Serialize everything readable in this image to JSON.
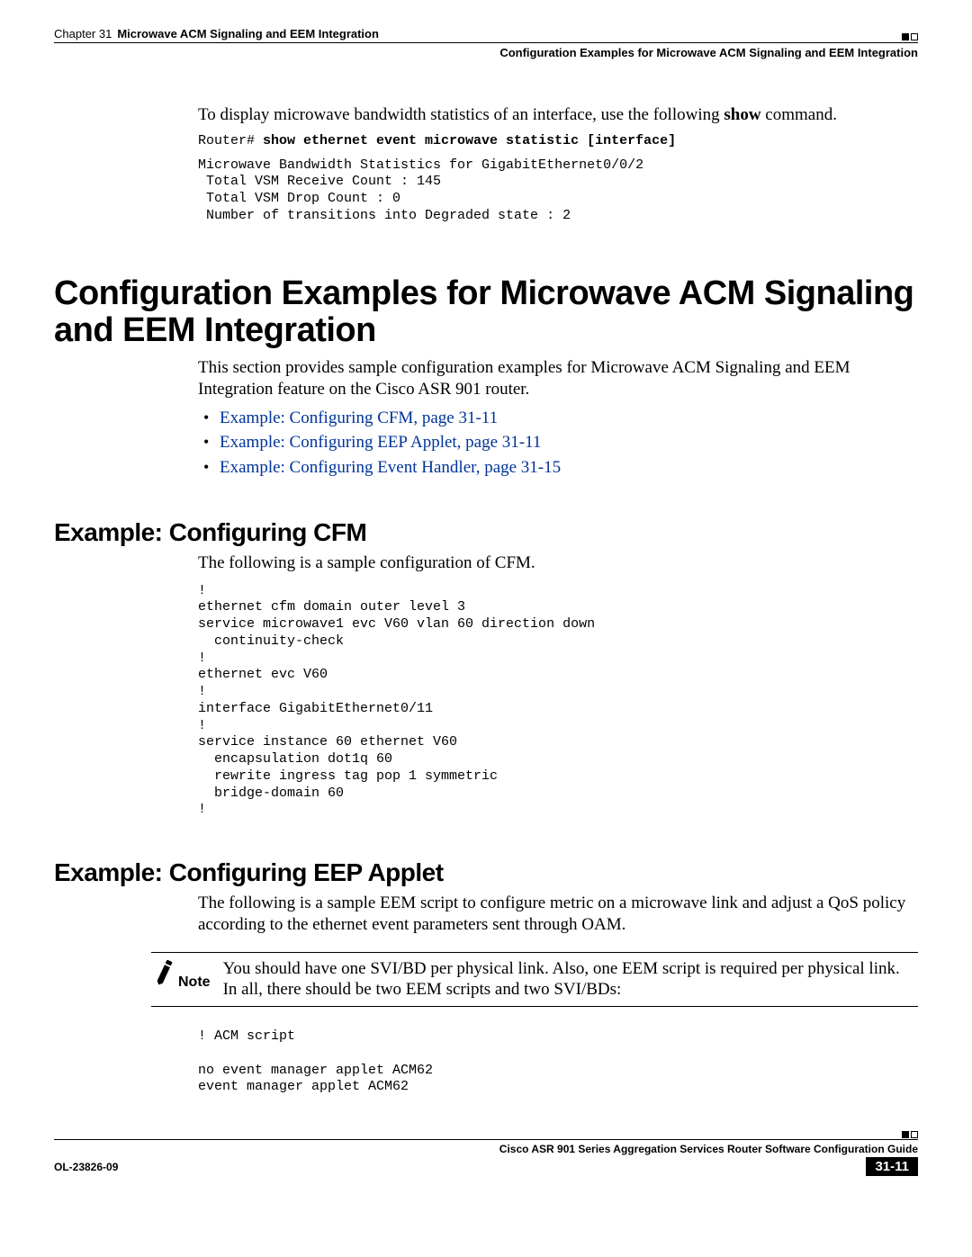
{
  "header": {
    "chapter_label": "Chapter 31",
    "chapter_title": "Microwave ACM Signaling and EEM Integration",
    "section_title": "Configuration Examples for Microwave ACM Signaling and EEM Integration"
  },
  "intro": {
    "text_before": "To display microwave bandwidth statistics of an interface, use the following ",
    "bold_word": "show",
    "text_after": " command.",
    "prompt": "Router# ",
    "command": "show ethernet event microwave statistic [interface]",
    "output": "Microwave Bandwidth Statistics for GigabitEthernet0/0/2\n Total VSM Receive Count : 145\n Total VSM Drop Count : 0\n Number of transitions into Degraded state : 2"
  },
  "main_heading": "Configuration Examples for Microwave ACM Signaling and EEM Integration",
  "main_para": "This section provides sample configuration examples for Microwave ACM Signaling and EEM Integration feature on the Cisco ASR 901 router.",
  "links": [
    "Example: Configuring CFM, page 31-11",
    "Example: Configuring EEP Applet, page 31-11",
    "Example: Configuring Event Handler, page 31-15"
  ],
  "cfm": {
    "heading": "Example: Configuring CFM",
    "para": "The following is a sample configuration of CFM.",
    "code": "!\nethernet cfm domain outer level 3\nservice microwave1 evc V60 vlan 60 direction down\n  continuity-check\n!\nethernet evc V60\n!\ninterface GigabitEthernet0/11\n!\nservice instance 60 ethernet V60\n  encapsulation dot1q 60\n  rewrite ingress tag pop 1 symmetric\n  bridge-domain 60\n!"
  },
  "eep": {
    "heading": "Example: Configuring EEP Applet",
    "para": "The following is a sample EEM script to configure metric on a microwave link and adjust a QoS policy according to the ethernet event parameters sent through OAM.",
    "note_label": "Note",
    "note_text": "You should have one SVI/BD per physical link. Also, one EEM script is required per physical link. In all, there should be two EEM scripts and two SVI/BDs:",
    "code": "! ACM script\n\nno event manager applet ACM62\nevent manager applet ACM62"
  },
  "footer": {
    "guide": "Cisco ASR 901 Series Aggregation Services Router Software Configuration Guide",
    "ol": "OL-23826-09",
    "page": "31-11"
  }
}
